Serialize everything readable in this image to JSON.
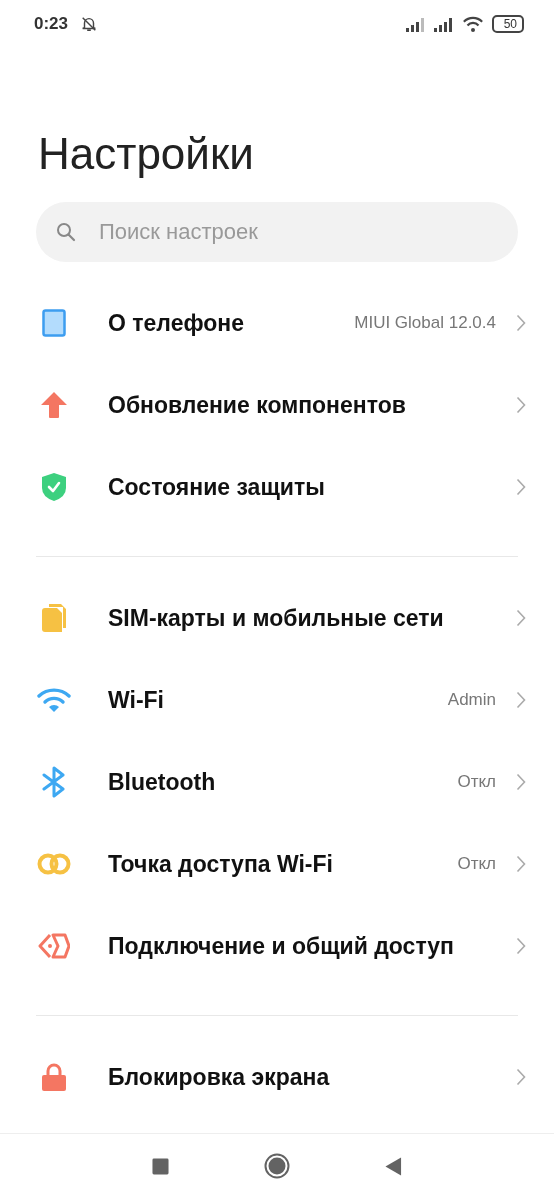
{
  "status_bar": {
    "time": "0:23",
    "battery": "50"
  },
  "title": "Настройки",
  "search": {
    "placeholder": "Поиск настроек"
  },
  "sections": [
    {
      "items": [
        {
          "label": "О телефоне",
          "value": "MIUI Global 12.0.4"
        },
        {
          "label": "Обновление компонентов"
        },
        {
          "label": "Состояние защиты"
        }
      ]
    },
    {
      "items": [
        {
          "label": "SIM-карты и мобильные сети"
        },
        {
          "label": "Wi-Fi",
          "value": "Admin"
        },
        {
          "label": "Bluetooth",
          "value": "Откл"
        },
        {
          "label": "Точка доступа Wi-Fi",
          "value": "Откл"
        },
        {
          "label": "Подключение и общий доступ"
        }
      ]
    },
    {
      "items": [
        {
          "label": "Блокировка экрана"
        }
      ]
    }
  ]
}
